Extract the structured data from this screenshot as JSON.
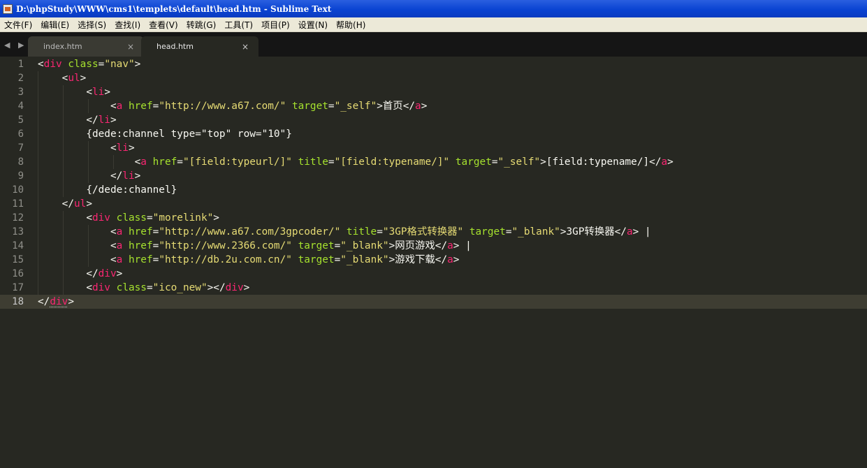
{
  "window": {
    "title": "D:\\phpStudy\\WWW\\cms1\\templets\\default\\head.htm - Sublime Text"
  },
  "menu": [
    "文件(F)",
    "编辑(E)",
    "选择(S)",
    "查找(I)",
    "查看(V)",
    "转跳(G)",
    "工具(T)",
    "项目(P)",
    "设置(N)",
    "帮助(H)"
  ],
  "tabs": [
    {
      "label": "index.htm",
      "close": "×",
      "active": false
    },
    {
      "label": "head.htm",
      "close": "×",
      "active": true
    }
  ],
  "nav_arrows": "◀ ▶",
  "editor": {
    "current_line": 18,
    "lines": [
      {
        "n": "1",
        "indent": 0,
        "tokens": [
          [
            "txt",
            "<"
          ],
          [
            "tag",
            "div"
          ],
          [
            "txt",
            " "
          ],
          [
            "attr",
            "class"
          ],
          [
            "txt",
            "="
          ],
          [
            "str",
            "\"nav\""
          ],
          [
            "txt",
            ">"
          ]
        ]
      },
      {
        "n": "2",
        "indent": 1,
        "tokens": [
          [
            "txt",
            "<"
          ],
          [
            "tag",
            "ul"
          ],
          [
            "txt",
            ">"
          ]
        ]
      },
      {
        "n": "3",
        "indent": 2,
        "tokens": [
          [
            "txt",
            "<"
          ],
          [
            "tag",
            "li"
          ],
          [
            "txt",
            ">"
          ]
        ]
      },
      {
        "n": "4",
        "indent": 3,
        "tokens": [
          [
            "txt",
            "<"
          ],
          [
            "tag",
            "a"
          ],
          [
            "txt",
            " "
          ],
          [
            "attr",
            "href"
          ],
          [
            "txt",
            "="
          ],
          [
            "str",
            "\"http://www.a67.com/\""
          ],
          [
            "txt",
            " "
          ],
          [
            "attr",
            "target"
          ],
          [
            "txt",
            "="
          ],
          [
            "str",
            "\"_self\""
          ],
          [
            "txt",
            ">首页</"
          ],
          [
            "tag",
            "a"
          ],
          [
            "txt",
            ">"
          ]
        ]
      },
      {
        "n": "5",
        "indent": 2,
        "tokens": [
          [
            "txt",
            "</"
          ],
          [
            "tag",
            "li"
          ],
          [
            "txt",
            ">"
          ]
        ]
      },
      {
        "n": "6",
        "indent": 2,
        "tokens": [
          [
            "txt",
            "{dede:channel type=\"top\" row=\"10\"}"
          ]
        ]
      },
      {
        "n": "7",
        "indent": 3,
        "tokens": [
          [
            "txt",
            "<"
          ],
          [
            "tag",
            "li"
          ],
          [
            "txt",
            ">"
          ]
        ]
      },
      {
        "n": "8",
        "indent": 4,
        "tokens": [
          [
            "txt",
            "<"
          ],
          [
            "tag",
            "a"
          ],
          [
            "txt",
            " "
          ],
          [
            "attr",
            "href"
          ],
          [
            "txt",
            "="
          ],
          [
            "str",
            "\"[field:typeurl/]\""
          ],
          [
            "txt",
            " "
          ],
          [
            "attr",
            "title"
          ],
          [
            "txt",
            "="
          ],
          [
            "str",
            "\"[field:typename/]\""
          ],
          [
            "txt",
            " "
          ],
          [
            "attr",
            "target"
          ],
          [
            "txt",
            "="
          ],
          [
            "str",
            "\"_self\""
          ],
          [
            "txt",
            ">[field:typename/]</"
          ],
          [
            "tag",
            "a"
          ],
          [
            "txt",
            ">"
          ]
        ]
      },
      {
        "n": "9",
        "indent": 3,
        "tokens": [
          [
            "txt",
            "</"
          ],
          [
            "tag",
            "li"
          ],
          [
            "txt",
            ">"
          ]
        ]
      },
      {
        "n": "10",
        "indent": 2,
        "tokens": [
          [
            "txt",
            "{/dede:channel}"
          ]
        ]
      },
      {
        "n": "11",
        "indent": 1,
        "tokens": [
          [
            "txt",
            "</"
          ],
          [
            "tag",
            "ul"
          ],
          [
            "txt",
            ">"
          ]
        ]
      },
      {
        "n": "12",
        "indent": 2,
        "tokens": [
          [
            "txt",
            "<"
          ],
          [
            "tag",
            "div"
          ],
          [
            "txt",
            " "
          ],
          [
            "attr",
            "class"
          ],
          [
            "txt",
            "="
          ],
          [
            "str",
            "\"morelink\""
          ],
          [
            "txt",
            ">"
          ]
        ]
      },
      {
        "n": "13",
        "indent": 3,
        "tokens": [
          [
            "txt",
            "<"
          ],
          [
            "tag",
            "a"
          ],
          [
            "txt",
            " "
          ],
          [
            "attr",
            "href"
          ],
          [
            "txt",
            "="
          ],
          [
            "str",
            "\"http://www.a67.com/3gpcoder/\""
          ],
          [
            "txt",
            " "
          ],
          [
            "attr",
            "title"
          ],
          [
            "txt",
            "="
          ],
          [
            "str",
            "\"3GP格式转换器\""
          ],
          [
            "txt",
            " "
          ],
          [
            "attr",
            "target"
          ],
          [
            "txt",
            "="
          ],
          [
            "str",
            "\"_blank\""
          ],
          [
            "txt",
            ">3GP转换器</"
          ],
          [
            "tag",
            "a"
          ],
          [
            "txt",
            "> |"
          ]
        ]
      },
      {
        "n": "14",
        "indent": 3,
        "tokens": [
          [
            "txt",
            "<"
          ],
          [
            "tag",
            "a"
          ],
          [
            "txt",
            " "
          ],
          [
            "attr",
            "href"
          ],
          [
            "txt",
            "="
          ],
          [
            "str",
            "\"http://www.2366.com/\""
          ],
          [
            "txt",
            " "
          ],
          [
            "attr",
            "target"
          ],
          [
            "txt",
            "="
          ],
          [
            "str",
            "\"_blank\""
          ],
          [
            "txt",
            ">网页游戏</"
          ],
          [
            "tag",
            "a"
          ],
          [
            "txt",
            "> |"
          ]
        ]
      },
      {
        "n": "15",
        "indent": 3,
        "tokens": [
          [
            "txt",
            "<"
          ],
          [
            "tag",
            "a"
          ],
          [
            "txt",
            " "
          ],
          [
            "attr",
            "href"
          ],
          [
            "txt",
            "="
          ],
          [
            "str",
            "\"http://db.2u.com.cn/\""
          ],
          [
            "txt",
            " "
          ],
          [
            "attr",
            "target"
          ],
          [
            "txt",
            "="
          ],
          [
            "str",
            "\"_blank\""
          ],
          [
            "txt",
            ">游戏下载</"
          ],
          [
            "tag",
            "a"
          ],
          [
            "txt",
            ">"
          ]
        ]
      },
      {
        "n": "16",
        "indent": 2,
        "tokens": [
          [
            "txt",
            "</"
          ],
          [
            "tag",
            "div"
          ],
          [
            "txt",
            ">"
          ]
        ]
      },
      {
        "n": "17",
        "indent": 2,
        "tokens": [
          [
            "txt",
            "<"
          ],
          [
            "tag",
            "div"
          ],
          [
            "txt",
            " "
          ],
          [
            "attr",
            "class"
          ],
          [
            "txt",
            "="
          ],
          [
            "str",
            "\"ico_new\""
          ],
          [
            "txt",
            "></"
          ],
          [
            "tag",
            "div"
          ],
          [
            "txt",
            ">"
          ]
        ]
      },
      {
        "n": "18",
        "indent": 0,
        "tokens": [
          [
            "txt",
            "</"
          ],
          [
            "tag",
            "div"
          ],
          [
            "txt",
            ">"
          ]
        ]
      }
    ]
  }
}
